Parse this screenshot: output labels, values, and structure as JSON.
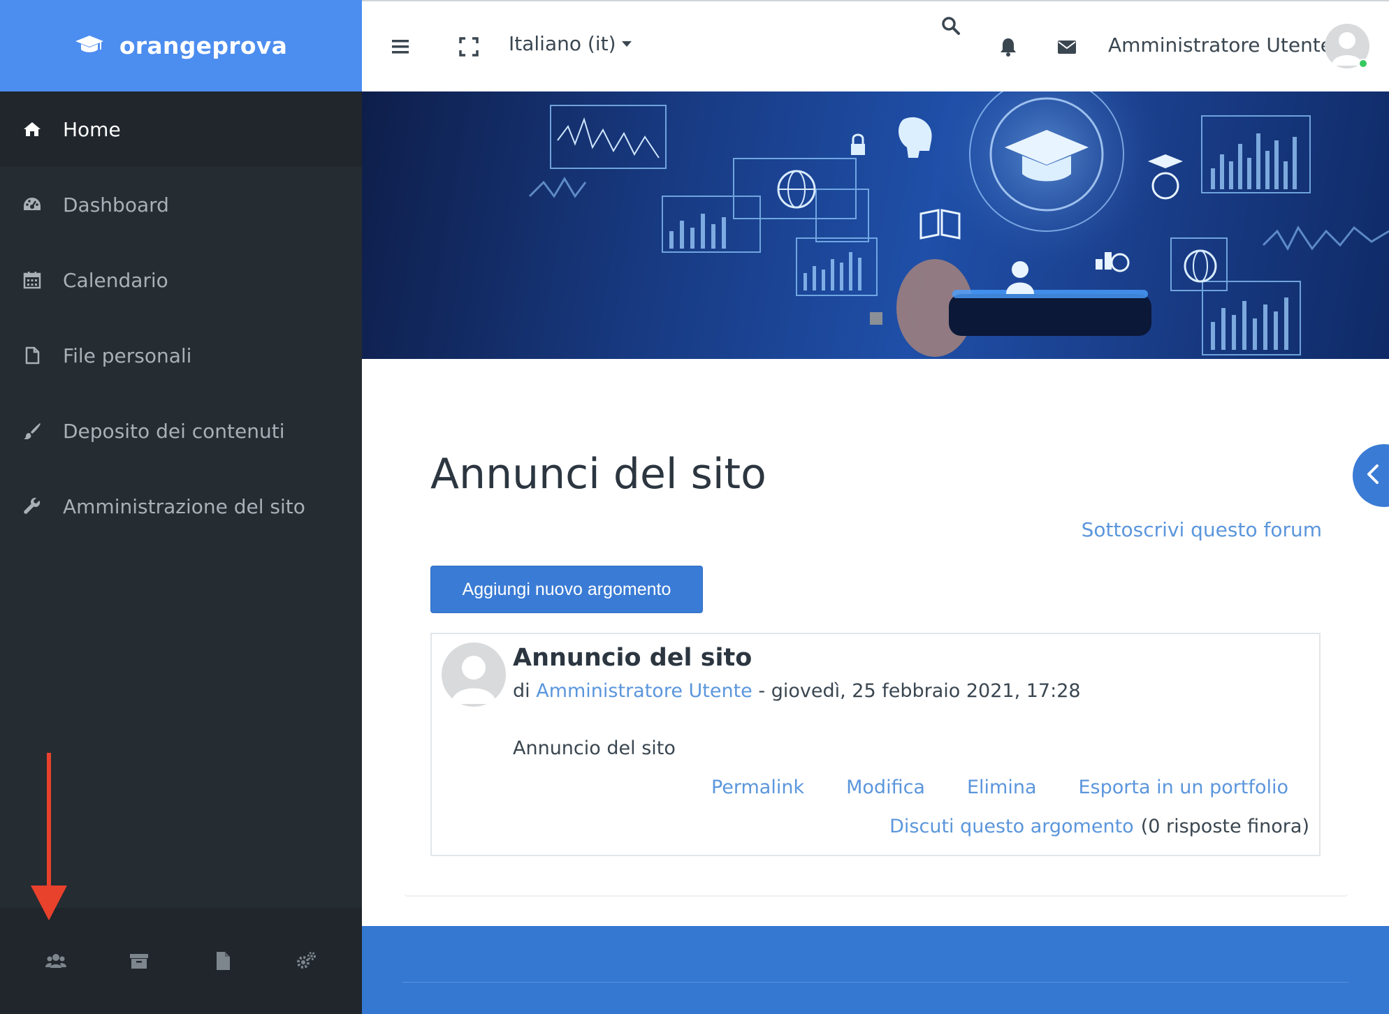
{
  "brand": {
    "name": "orangeprova"
  },
  "sidebar": {
    "items": [
      {
        "label": "Home",
        "icon": "home-icon",
        "active": true
      },
      {
        "label": "Dashboard",
        "icon": "dashboard-icon",
        "active": false
      },
      {
        "label": "Calendario",
        "icon": "calendar-icon",
        "active": false
      },
      {
        "label": "File personali",
        "icon": "file-icon",
        "active": false
      },
      {
        "label": "Deposito dei contenuti",
        "icon": "paintbrush-icon",
        "active": false
      },
      {
        "label": "Amministrazione del sito",
        "icon": "wrench-icon",
        "active": false
      }
    ],
    "bottom_icons": [
      "users-icon",
      "archive-icon",
      "document-icon",
      "cogs-icon"
    ]
  },
  "topbar": {
    "language": "Italiano (it)",
    "user_name": "Amministratore Utente",
    "icons": [
      "menu-icon",
      "fullscreen-icon",
      "search-icon",
      "bell-icon",
      "envelope-icon"
    ]
  },
  "main": {
    "title": "Annunci del sito",
    "subscribe_link": "Sottoscrivi questo forum",
    "add_button": "Aggiungi nuovo argomento",
    "post": {
      "title": "Annuncio del sito",
      "by_prefix": "di",
      "author": "Amministratore Utente",
      "date": "- giovedì, 25 febbraio 2021, 17:28",
      "body": "Annuncio del sito",
      "actions": [
        "Permalink",
        "Modifica",
        "Elimina",
        "Esporta in un portfolio"
      ],
      "discuss_link": "Discuti questo argomento",
      "replies": "(0 risposte finora)"
    }
  },
  "colors": {
    "brand_blue": "#4c8df0",
    "sidebar_bg": "#252c32",
    "link_blue": "#5b96dc",
    "button_blue": "#3a7bd5",
    "annotation_red": "#e8412c"
  }
}
